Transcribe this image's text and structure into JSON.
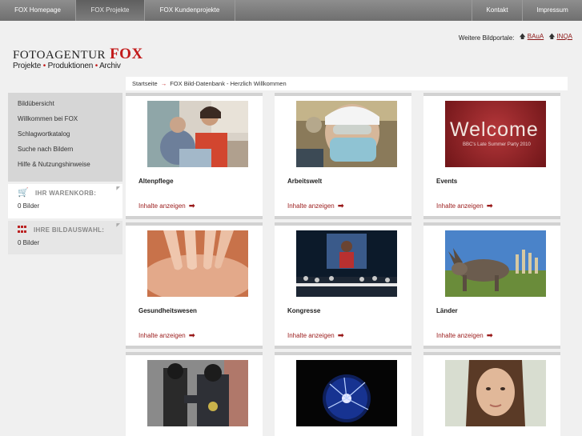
{
  "nav": {
    "items": [
      "FOX Homepage",
      "FOX Projekte",
      "FOX Kundenprojekte"
    ],
    "right": [
      "Kontakt",
      "Impressum"
    ]
  },
  "portals": {
    "label": "Weitere Bildportale:",
    "links": [
      "BAuA",
      "INQA"
    ]
  },
  "logo": {
    "line1": "Fotoagentur",
    "fox": "FOX",
    "line2a": "Projekte",
    "line2b": "Produktionen",
    "line2c": "Archiv"
  },
  "breadcrumb": {
    "home": "Startseite",
    "current": "FOX Bild-Datenbank - Herzlich Willkommen"
  },
  "sidebar": {
    "menu": [
      "Bildübersicht",
      "Willkommen bei FOX",
      "Schlagwortkatalog",
      "Suche nach Bildern",
      "Hilfe & Nutzungshinweise"
    ],
    "cart": {
      "title": "IHR WARENKORB:",
      "count": "0 Bilder"
    },
    "selection": {
      "title": "IHRE BILDAUSWAHL:",
      "count": "0 Bilder"
    }
  },
  "cards": [
    {
      "title": "Altenpflege",
      "link": "Inhalte anzeigen"
    },
    {
      "title": "Arbeitswelt",
      "link": "Inhalte anzeigen"
    },
    {
      "title": "Events",
      "link": "Inhalte anzeigen",
      "photo_text": "Welcome",
      "photo_sub": "BBC's Late Summer Party 2010"
    },
    {
      "title": "Gesundheitswesen",
      "link": "Inhalte anzeigen"
    },
    {
      "title": "Kongresse",
      "link": "Inhalte anzeigen"
    },
    {
      "title": "Länder",
      "link": "Inhalte anzeigen"
    }
  ],
  "colors": {
    "accent": "#c21a1a",
    "link": "#9a1a1a",
    "nav": "#7a7a7a"
  }
}
